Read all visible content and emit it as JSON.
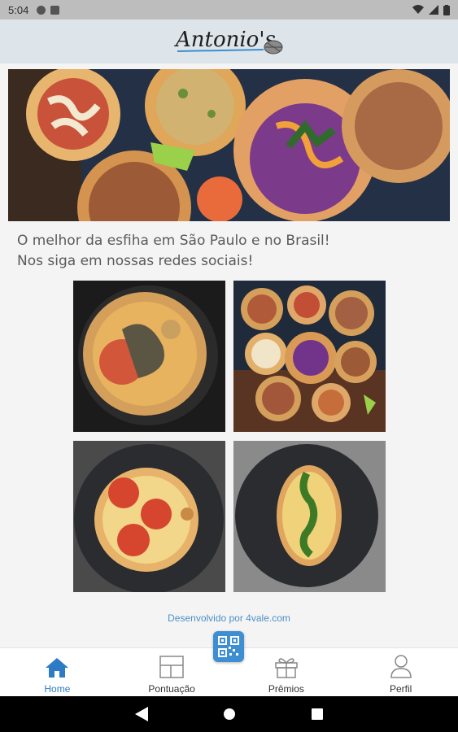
{
  "status_bar": {
    "time": "5:04"
  },
  "header": {
    "logo_text": "Antonio's"
  },
  "main": {
    "tagline_line1": "O melhor da esfiha em São Paulo e no Brasil!",
    "tagline_line2": "Nos siga em nossas redes sociais!",
    "developer_credit": "Desenvolvido por 4vale.com"
  },
  "tabs": [
    {
      "label": "Home",
      "icon": "home-icon",
      "active": true
    },
    {
      "label": "Pontuação",
      "icon": "dashboard-icon",
      "active": false
    },
    {
      "label": "Prêmios",
      "icon": "gift-icon",
      "active": false
    },
    {
      "label": "Perfil",
      "icon": "user-icon",
      "active": false
    }
  ],
  "colors": {
    "accent": "#2d7bc4",
    "header_bg": "#dde4ea",
    "status_bg": "#bdbdbd",
    "link": "#4a90c8"
  }
}
